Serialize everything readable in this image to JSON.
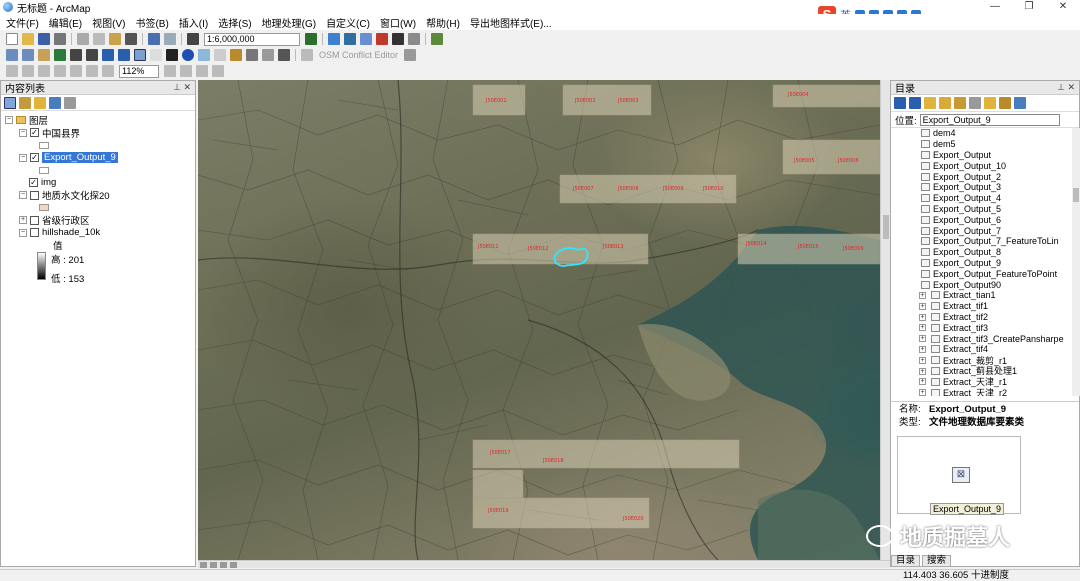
{
  "window": {
    "title": "无标题 - ArcMap",
    "controls": [
      "—",
      "❐",
      "✕"
    ]
  },
  "menu": [
    "文件(F)",
    "编辑(E)",
    "视图(V)",
    "书签(B)",
    "插入(I)",
    "选择(S)",
    "地理处理(G)",
    "自定义(C)",
    "窗口(W)",
    "帮助(H)",
    "导出地图样式(E)..."
  ],
  "ime": {
    "logo": "S",
    "label": "英"
  },
  "toolbar": {
    "scale": "1:6,000,000",
    "osm": "OSM Conflict Editor",
    "zoom": "112%"
  },
  "toc": {
    "title": "内容列表",
    "header_ctrls": "⊥ ✕",
    "group": "图层",
    "layers": [
      {
        "name": "中国县界",
        "checked": true
      },
      {
        "name": "Export_Output_9",
        "checked": true,
        "selected": true
      },
      {
        "name": "img",
        "checked": true
      },
      {
        "name": "地质水文化探20",
        "checked": false
      },
      {
        "name": "省级行政区",
        "checked": false
      },
      {
        "name": "hillshade_10k",
        "checked": false
      }
    ],
    "ramp_label": "值",
    "ramp_high": "高 : 201",
    "ramp_low": "低 : 153"
  },
  "map": {
    "tile_labels": [
      "J50E001",
      "J50E002",
      "J50E003",
      "J50E004",
      "J50E005",
      "J50E006",
      "J50E007",
      "J50E008",
      "J50E009",
      "J50E010",
      "J50E011",
      "J50E012",
      "J50E013",
      "J50E014",
      "J50E015",
      "J50E016",
      "J50E017",
      "J50E018",
      "J50E019",
      "J50E020"
    ]
  },
  "catalog": {
    "title": "目录",
    "header_ctrls": "⊥ ✕",
    "location_label": "位置:",
    "location_value": "Export_Output_9",
    "items": [
      {
        "label": "dem4",
        "exp": false
      },
      {
        "label": "dem5",
        "exp": false
      },
      {
        "label": "Export_Output",
        "exp": false
      },
      {
        "label": "Export_Output_10",
        "exp": false
      },
      {
        "label": "Export_Output_2",
        "exp": false
      },
      {
        "label": "Export_Output_3",
        "exp": false
      },
      {
        "label": "Export_Output_4",
        "exp": false
      },
      {
        "label": "Export_Output_5",
        "exp": false
      },
      {
        "label": "Export_Output_6",
        "exp": false
      },
      {
        "label": "Export_Output_7",
        "exp": false
      },
      {
        "label": "Export_Output_7_FeatureToLin",
        "exp": false
      },
      {
        "label": "Export_Output_8",
        "exp": false
      },
      {
        "label": "Export_Output_9",
        "exp": false
      },
      {
        "label": "Export_Output_FeatureToPoint",
        "exp": false
      },
      {
        "label": "Export_Output90",
        "exp": false
      },
      {
        "label": "Extract_tian1",
        "exp": true
      },
      {
        "label": "Extract_tif1",
        "exp": true
      },
      {
        "label": "Extract_tif2",
        "exp": true
      },
      {
        "label": "Extract_tif3",
        "exp": true
      },
      {
        "label": "Extract_tif3_CreatePansharpe",
        "exp": true
      },
      {
        "label": "Extract_tif4",
        "exp": true
      },
      {
        "label": "Extract_裁剪_r1",
        "exp": true
      },
      {
        "label": "Extract_蓟县处理1",
        "exp": true
      },
      {
        "label": "Extract_天津_r1",
        "exp": true
      },
      {
        "label": "Extract_天津_r2",
        "exp": true
      }
    ],
    "info_name_label": "名称:",
    "info_name": "Export_Output_9",
    "info_type_label": "类型:",
    "info_type": "文件地理数据库要素类",
    "preview_label": "Export_Output_9",
    "tabs": [
      "目录",
      "搜索"
    ]
  },
  "status": {
    "coords": "114.403  36.605 十进制度"
  },
  "watermark": {
    "text": "地质掘墓人"
  }
}
